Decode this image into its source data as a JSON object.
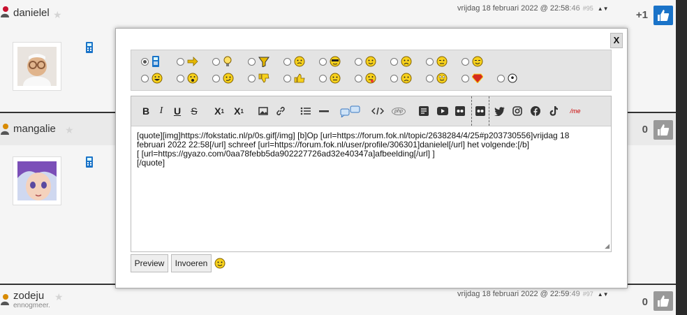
{
  "posts": [
    {
      "username": "danielel",
      "subtitle": "",
      "date": "vrijdag 18 februari 2022 @ 22:58",
      "seconds": ":46",
      "post_number": "#95",
      "score": "+1",
      "liked": true
    },
    {
      "username": "mangalie",
      "subtitle": "",
      "date": "",
      "seconds": "",
      "post_number": "",
      "score": "0",
      "liked": false
    },
    {
      "username": "zodeju",
      "subtitle": "ennogmeer.",
      "date": "vrijdag 18 februari 2022 @ 22:59",
      "seconds": ":49",
      "post_number": "#97",
      "score": "0",
      "liked": false
    }
  ],
  "vote_arrows": "▲▼",
  "modal": {
    "close_label": "X",
    "smileys": {
      "row1": [
        "phone-icon",
        "arrow-right-icon",
        "lightbulb-icon",
        "funnel-icon",
        "confused-icon",
        "sunglasses-icon",
        "smile-icon",
        "worried-icon",
        "wink-icon",
        "squint-icon"
      ],
      "row2": [
        "grin-icon",
        "shocked-icon",
        "smirk-icon",
        "thumbs-down-icon",
        "thumbs-up-icon",
        "neutral-icon",
        "tongue-icon",
        "frown-icon",
        "blush-icon",
        "superman-icon",
        "soccer-ball-icon"
      ],
      "selected": "phone-icon"
    },
    "toolbar": {
      "bold": "B",
      "italic": "I",
      "underline": "U",
      "strike": "S",
      "subscript": "X",
      "subscript_mark": "1",
      "superscript": "X",
      "superscript_mark": "1",
      "me": "/me",
      "php": "php"
    },
    "editor_lines": [
      "[quote][img]https://fokstatic.nl/p/0s.gif[/img] [b]Op [url=https://forum.fok.nl/topic/2638284/4/25#p203730556]vrijdag 18",
      "februari 2022 22:58[/url] schreef [url=https://forum.fok.nl/user/profile/306301]danielel[/url] het volgende:[/b]",
      "[ [url=https://gyazo.com/0aa78febb5da902227726ad32e40347a]afbeelding[/url] ]",
      "[/quote]"
    ],
    "preview_label": "Preview",
    "submit_label": "Invoeren"
  }
}
